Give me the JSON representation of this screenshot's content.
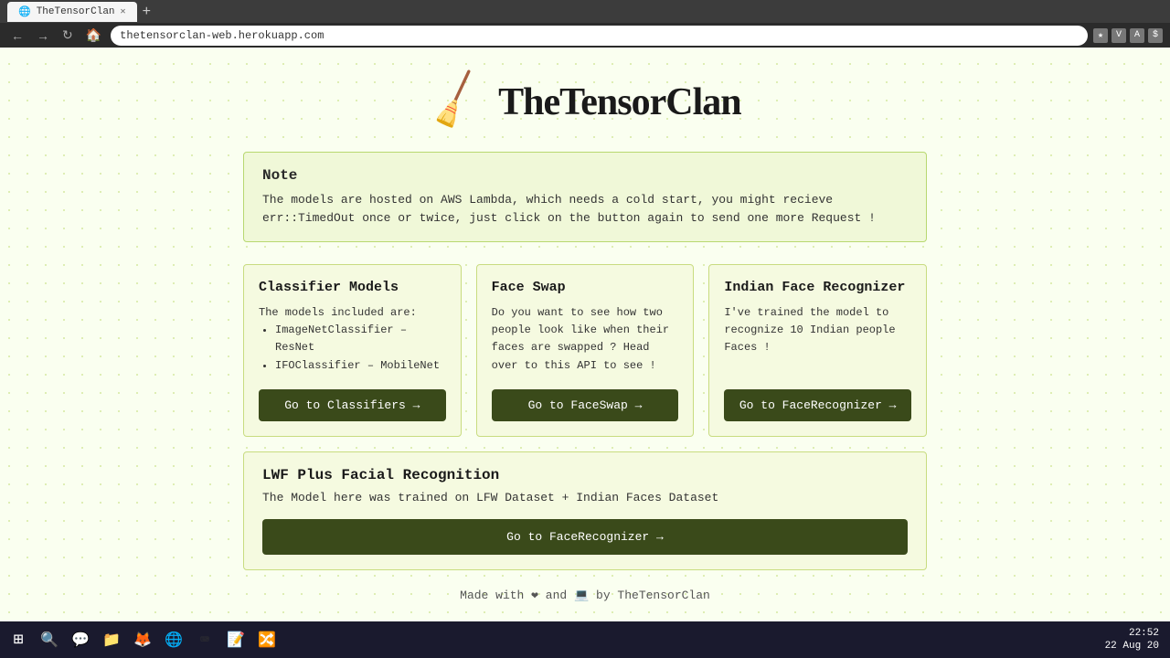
{
  "browser": {
    "tab_title": "TheTensorClan",
    "url": "thetensorclan-web.herokuapp.com",
    "new_tab_label": "+"
  },
  "header": {
    "broom_icon": "🧹",
    "site_title": "TheTensorClan"
  },
  "note": {
    "title": "Note",
    "text": "The models are hosted on AWS Lambda, which needs a cold start, you might recieve err::TimedOut once or twice, just click on the button again to send one more Request !"
  },
  "cards": [
    {
      "title": "Classifier Models",
      "intro": "The models included are:",
      "items": [
        "ImageNetClassifier – ResNet",
        "IFOClassifier – MobileNet"
      ],
      "button_label": "Go to Classifiers →"
    },
    {
      "title": "Face Swap",
      "body": "Do you want to see how two people look like when their faces are swapped ? Head over to this API to see !",
      "button_label": "Go to FaceSwap →"
    },
    {
      "title": "Indian Face Recognizer",
      "body": "I've trained the model to recognize 10 Indian people Faces !",
      "button_label": "Go to FaceRecognizer →"
    }
  ],
  "wide_section": {
    "title": "LWF Plus Facial Recognition",
    "body": "The Model here was trained on LFW Dataset + Indian Faces Dataset",
    "button_label": "Go to FaceRecognizer →"
  },
  "footer": {
    "text_before": "Made with ",
    "heart": "❤",
    "and": "and",
    "laptop": "💻",
    "text_after": "by TheTensorClan"
  },
  "taskbar": {
    "time": "22:52",
    "date": "22 Aug 20"
  }
}
